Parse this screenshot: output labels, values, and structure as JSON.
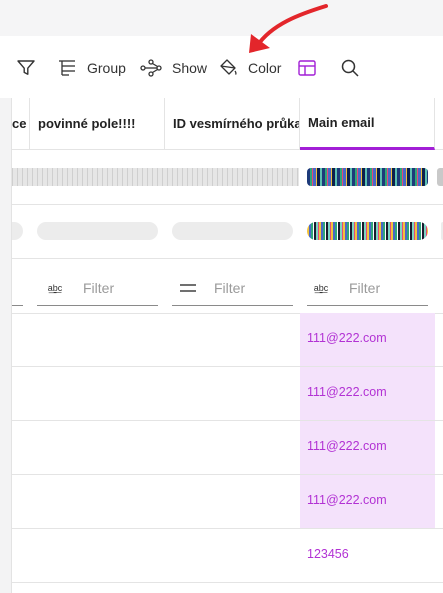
{
  "toolbar": {
    "items": [
      {
        "name": "filter",
        "label": ""
      },
      {
        "name": "group",
        "label": "Group"
      },
      {
        "name": "show",
        "label": "Show"
      },
      {
        "name": "color",
        "label": "Color"
      }
    ]
  },
  "columns": [
    {
      "label": "ce"
    },
    {
      "label": "povinné pole!!!!"
    },
    {
      "label": "ID vesmírného průkazu"
    },
    {
      "label": "Main email"
    }
  ],
  "filters": {
    "placeholder": "Filter",
    "type_icon_text": "a͟b͟c"
  },
  "rows": [
    {
      "main_email": "111@222.com"
    },
    {
      "main_email": "111@222.com"
    },
    {
      "main_email": "111@222.com"
    },
    {
      "main_email": "111@222.com"
    },
    {
      "main_email": "123456"
    }
  ],
  "colors": {
    "accent": "#a21fd6",
    "highlight": "#f4e2fb",
    "link_text": "#b232d4",
    "arrow": "#e3262b"
  }
}
